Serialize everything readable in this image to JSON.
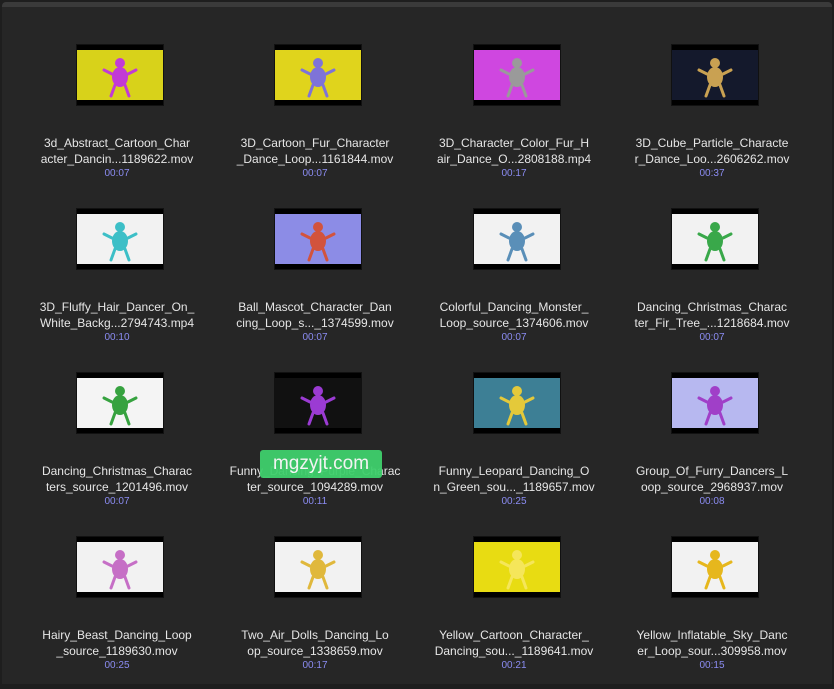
{
  "files": [
    {
      "line1": "3d_Abstract_Cartoon_Char",
      "line2": "acter_Dancin...1189622.mov",
      "duration": "00:07",
      "bg": "#d8d21a",
      "fg": "#c23ad6",
      "icon": "dancing-figure-thumbnail"
    },
    {
      "line1": "3D_Cartoon_Fur_Character",
      "line2": "_Dance_Loop...1161844.mov",
      "duration": "00:07",
      "bg": "#e0d41c",
      "fg": "#7e73d8",
      "icon": "fur-character-thumbnail"
    },
    {
      "line1": "3D_Character_Color_Fur_H",
      "line2": "air_Dance_O...2808188.mp4",
      "duration": "00:17",
      "bg": "#cf47e0",
      "fg": "#9a9a9a",
      "icon": "color-fur-character-thumbnail"
    },
    {
      "line1": "3D_Cube_Particle_Characte",
      "line2": "r_Dance_Loo...2606262.mov",
      "duration": "00:37",
      "bg": "#14192c",
      "fg": "#c9a152",
      "icon": "particle-character-thumbnail"
    },
    {
      "line1": "3D_Fluffy_Hair_Dancer_On_",
      "line2": "White_Backg...2794743.mp4",
      "duration": "00:10",
      "bg": "#f2f2f2",
      "fg": "#3dbfc7",
      "icon": "fluffy-dancer-thumbnail"
    },
    {
      "line1": "Ball_Mascot_Character_Dan",
      "line2": "cing_Loop_s..._1374599.mov",
      "duration": "00:07",
      "bg": "#8c8ce6",
      "fg": "#d2533d",
      "icon": "ball-mascot-thumbnail"
    },
    {
      "line1": "Colorful_Dancing_Monster_",
      "line2": "Loop_source_1374606.mov",
      "duration": "00:07",
      "bg": "#f2f2f2",
      "fg": "#5a8fb8",
      "icon": "colorful-monster-thumbnail"
    },
    {
      "line1": "Dancing_Christmas_Charac",
      "line2": "ter_Fir_Tree_...1218684.mov",
      "duration": "00:07",
      "bg": "#f2f2f2",
      "fg": "#39a84a",
      "icon": "christmas-tree-thumbnail"
    },
    {
      "line1": "Dancing_Christmas_Charac",
      "line2": "ters_source_1201496.mov",
      "duration": "00:07",
      "bg": "#f4f4f4",
      "fg": "#36a23f",
      "icon": "christmas-characters-thumbnail"
    },
    {
      "line1": "Funny_Dancing_Purple_Charac",
      "line2": "ter_source_1094289.mov",
      "duration": "00:11",
      "bg": "#111111",
      "fg": "#9b3bd3",
      "icon": "purple-character-thumbnail"
    },
    {
      "line1": "Funny_Leopard_Dancing_O",
      "line2": "n_Green_sou..._1189657.mov",
      "duration": "00:25",
      "bg": "#3d7f95",
      "fg": "#e4c93a",
      "icon": "leopard-dancer-thumbnail"
    },
    {
      "line1": "Group_Of_Furry_Dancers_L",
      "line2": "oop_source_2968937.mov",
      "duration": "00:08",
      "bg": "#b7b8f0",
      "fg": "#a03fc8",
      "icon": "furry-dancers-group-thumbnail"
    },
    {
      "line1": "Hairy_Beast_Dancing_Loop",
      "line2": "_source_1189630.mov",
      "duration": "00:25",
      "bg": "#f2f2f2",
      "fg": "#c66fc6",
      "icon": "hairy-beast-thumbnail"
    },
    {
      "line1": "Two_Air_Dolls_Dancing_Lo",
      "line2": "op_source_1338659.mov",
      "duration": "00:17",
      "bg": "#f2f2f2",
      "fg": "#e0b83c",
      "icon": "air-dolls-thumbnail"
    },
    {
      "line1": "Yellow_Cartoon_Character_",
      "line2": "Dancing_sou..._1189641.mov",
      "duration": "00:21",
      "bg": "#e8dc12",
      "fg": "#f5e65a",
      "icon": "yellow-cartoon-thumbnail"
    },
    {
      "line1": "Yellow_Inflatable_Sky_Danc",
      "line2": "er_Loop_sour...309958.mov",
      "duration": "00:15",
      "bg": "#f2f2f2",
      "fg": "#e6b71d",
      "icon": "inflatable-dancer-thumbnail"
    }
  ],
  "watermark": "mgzyjt.com"
}
